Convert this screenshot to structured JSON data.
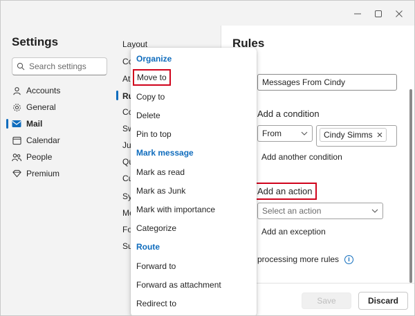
{
  "settings": {
    "title": "Settings",
    "search_placeholder": "Search settings",
    "nav": [
      {
        "label": "Accounts",
        "icon": "person-icon"
      },
      {
        "label": "General",
        "icon": "gear-icon"
      },
      {
        "label": "Mail",
        "icon": "mail-icon",
        "active": true
      },
      {
        "label": "Calendar",
        "icon": "calendar-icon"
      },
      {
        "label": "People",
        "icon": "people-icon"
      },
      {
        "label": "Premium",
        "icon": "diamond-icon"
      }
    ]
  },
  "middle": {
    "items": [
      "Layout",
      "Co",
      "At",
      "Ru",
      "Co",
      "Sw",
      "Ju",
      "Qu",
      "Cu",
      "Sy",
      "Me",
      "Fo",
      "Su"
    ]
  },
  "rules": {
    "title": "Rules",
    "rule_name": "Messages From Cindy",
    "condition_heading": "Add a condition",
    "condition_select": "From",
    "condition_chip": "Cindy Simms",
    "add_condition": "Add another condition",
    "action_heading": "Add an action",
    "action_placeholder": "Select an action",
    "add_exception": "Add an exception",
    "stop_processing": "p processing more rules",
    "save": "Save",
    "discard": "Discard"
  },
  "menu": {
    "group_organize": "Organize",
    "move_to": "Move to",
    "copy_to": "Copy to",
    "delete": "Delete",
    "pin_to_top": "Pin to top",
    "group_mark": "Mark message",
    "mark_as_read": "Mark as read",
    "mark_as_junk": "Mark as Junk",
    "mark_importance": "Mark with importance",
    "categorize": "Categorize",
    "group_route": "Route",
    "forward_to": "Forward to",
    "forward_attachment": "Forward as attachment",
    "redirect_to": "Redirect to"
  },
  "colors": {
    "accent": "#0f6cbd",
    "highlight_box": "#d0021b"
  }
}
